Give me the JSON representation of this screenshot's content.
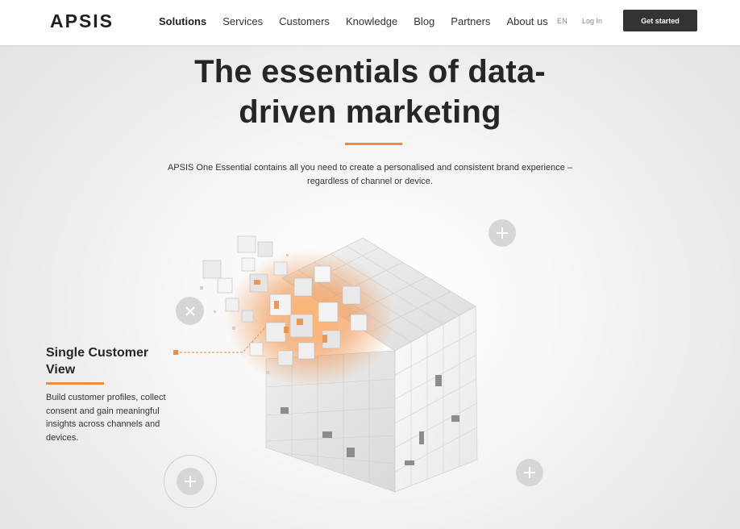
{
  "nav": {
    "logo_text": "APSIS",
    "links": [
      "Solutions",
      "Services",
      "Customers",
      "Knowledge",
      "Blog",
      "Partners",
      "About us"
    ],
    "active_link": "Solutions",
    "language": "EN",
    "login": "Log In",
    "cta": "Get started"
  },
  "hero": {
    "title_line1": "The essentials of data-",
    "title_line2": "driven marketing",
    "subtitle_line1": "APSIS One Essential contains all you need to create a personalised and consistent brand experience –",
    "subtitle_line2": "regardless of channel or device."
  },
  "feature": {
    "title": "Single Customer View",
    "description": "Build customer profiles, collect consent and gain meaningful insights across channels and devices."
  },
  "icons": {
    "plus": "plus-icon",
    "close": "close-icon"
  },
  "colors": {
    "accent": "#f08a3c",
    "cta_bg": "#333333",
    "button_circle": "#d6d6d6",
    "text_dark": "#262626"
  }
}
